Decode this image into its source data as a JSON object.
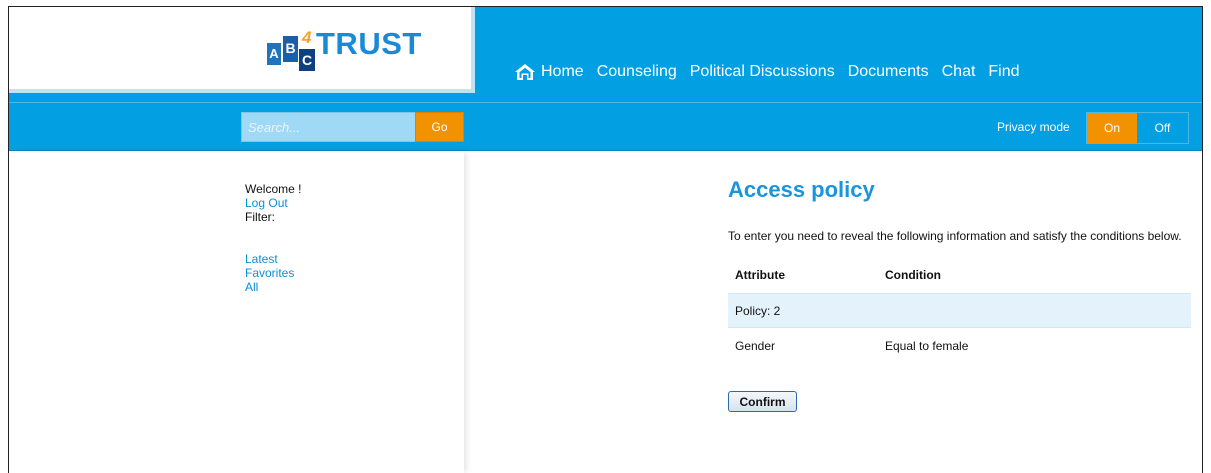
{
  "logo": {
    "letters": [
      "A",
      "B",
      "C"
    ],
    "superscript": "4",
    "word": "TRUST"
  },
  "nav": {
    "home_label": "Home",
    "items": [
      "Counseling",
      "Political Discussions",
      "Documents",
      "Chat",
      "Find"
    ]
  },
  "search": {
    "placeholder": "Search...",
    "go_label": "Go"
  },
  "privacy": {
    "label": "Privacy mode",
    "on_label": "On",
    "off_label": "Off",
    "active": "On"
  },
  "sidebar": {
    "welcome": "Welcome !",
    "logout": "Log Out",
    "filter_label": "Filter:",
    "filters": [
      "Latest",
      "Favorites",
      "All"
    ]
  },
  "main": {
    "title": "Access policy",
    "intro": "To enter you need to reveal the following information and satisfy the conditions below.",
    "table": {
      "headers": [
        "Attribute",
        "Condition"
      ],
      "rows": [
        [
          "Policy: 2",
          ""
        ],
        [
          "Gender",
          "Equal to female"
        ]
      ]
    },
    "confirm_label": "Confirm"
  },
  "colors": {
    "header_blue": "#029fe2",
    "accent_orange": "#f39200",
    "title_blue": "#1a95dd",
    "link_blue": "#0a8fdb",
    "row_highlight": "#e4f3fb"
  },
  "icons": {
    "home": "home-icon"
  }
}
